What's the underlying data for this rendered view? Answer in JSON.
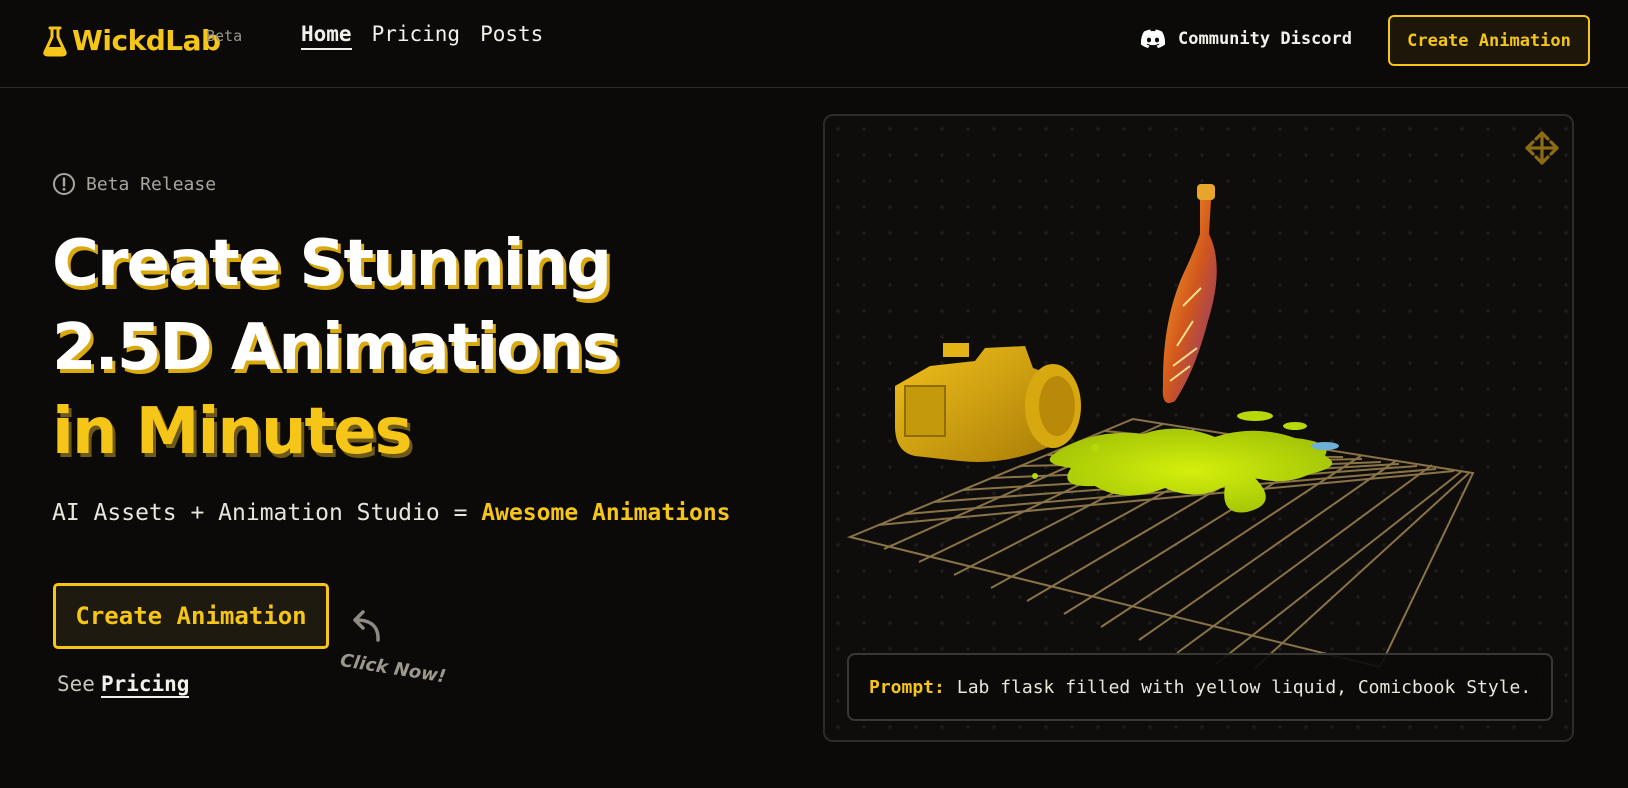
{
  "brand": {
    "name": "WickdLab",
    "badge": "Beta",
    "accent": "#f5c518"
  },
  "nav": {
    "items": [
      {
        "label": "Home"
      },
      {
        "label": "Pricing"
      },
      {
        "label": "Posts"
      }
    ],
    "active": "Home"
  },
  "header": {
    "discord_label": "Community Discord",
    "cta_label": "Create Animation"
  },
  "hero": {
    "badge_label": "Beta Release",
    "headline": {
      "line1": "Create Stunning",
      "line2": "2.5D Animations",
      "line3": "in Minutes"
    },
    "tagline": {
      "prefix": "AI Assets + Animation Studio = ",
      "highlight": "Awesome Animations"
    },
    "cta_label": "Create Animation",
    "click_hint": "Click Now!",
    "see_prefix": "See",
    "see_link": "Pricing"
  },
  "preview": {
    "prompt_label": "Prompt:",
    "prompt_text": "Lab flask filled with yellow liquid, Comicbook Style.",
    "icons": {
      "move": "move-arrows-icon"
    }
  },
  "icons": {
    "logo": "flask-icon",
    "discord": "discord-icon",
    "beta": "info-circle-icon",
    "hint": "curved-arrow-icon"
  }
}
